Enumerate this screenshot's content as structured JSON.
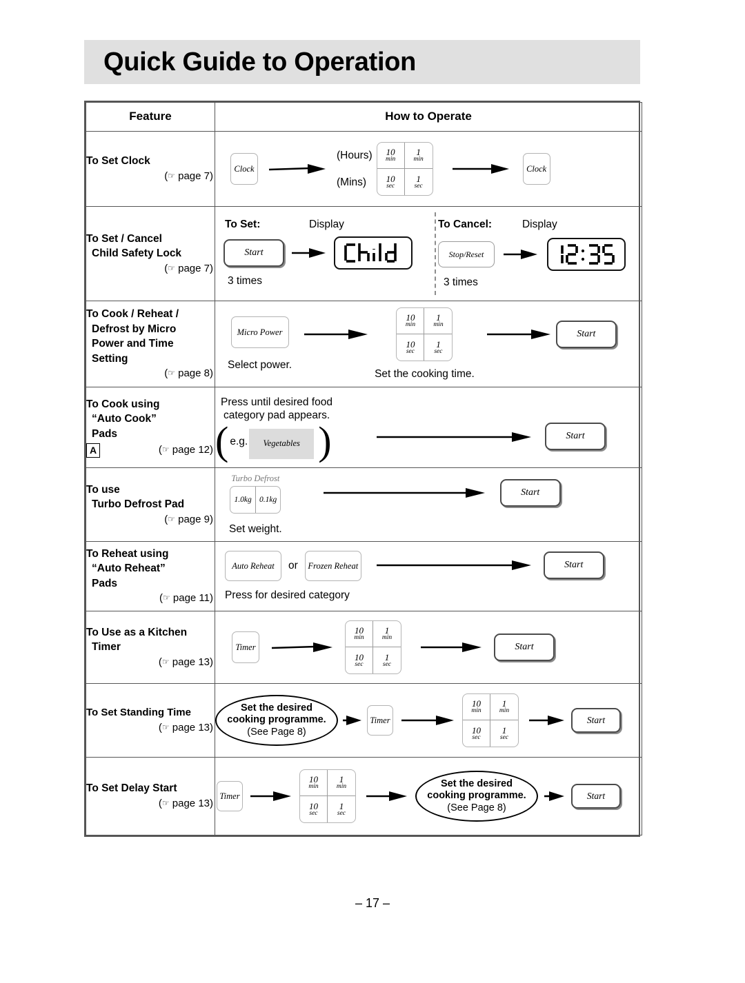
{
  "page": {
    "title": "Quick Guide to Operation",
    "footer": "– 17 –"
  },
  "table": {
    "headers": {
      "feature": "Feature",
      "how_to_operate": "How to Operate"
    },
    "rows": [
      {
        "id": "set-clock",
        "feature_lines": [
          "To Set Clock"
        ],
        "page_ref": "(☞ page 7)",
        "page_ref_prefix": "(",
        "page_ref_text": "page 7)",
        "steps": {
          "clock_pad": "Clock",
          "hours_label": "(Hours)",
          "mins_label": "(Mins)",
          "grid": [
            {
              "big": "10",
              "sml": "min"
            },
            {
              "big": "1",
              "sml": "min"
            },
            {
              "big": "10",
              "sml": "sec"
            },
            {
              "big": "1",
              "sml": "sec"
            }
          ],
          "clock_pad_2": "Clock"
        }
      },
      {
        "id": "child-safety-lock",
        "feature_lines": [
          "To Set / Cancel",
          "Child Safety Lock"
        ],
        "page_ref_text": "page 7)",
        "steps": {
          "to_set_label": "To Set:",
          "display_label_left": "Display",
          "start_pad": "Start",
          "set_times": "3 times",
          "display_left": "Child",
          "to_cancel_label": "To Cancel:",
          "display_label_right": "Display",
          "stop_reset_pad": "Stop/Reset",
          "cancel_times": "3 times",
          "display_right": "12:35"
        }
      },
      {
        "id": "micro-power",
        "feature_lines": [
          "To Cook / Reheat /",
          "Defrost by Micro",
          "Power and Time",
          "Setting"
        ],
        "page_ref_text": "page 8)",
        "steps": {
          "micro_power_pad": "Micro Power",
          "select_power_caption": "Select power.",
          "grid": [
            {
              "big": "10",
              "sml": "min"
            },
            {
              "big": "1",
              "sml": "min"
            },
            {
              "big": "10",
              "sml": "sec"
            },
            {
              "big": "1",
              "sml": "sec"
            }
          ],
          "set_time_caption": "Set the cooking time.",
          "start_pad": "Start"
        }
      },
      {
        "id": "auto-cook",
        "feature_lines": [
          "To Cook using",
          "“Auto Cook”",
          "Pads"
        ],
        "feature_badge": "A",
        "page_ref_text": "page 12)",
        "steps": {
          "instruction_line1": "Press until desired food",
          "instruction_line2": "category pad appears.",
          "eg_label": "e.g.",
          "category_pad": "Vegetables",
          "start_pad": "Start"
        }
      },
      {
        "id": "turbo-defrost",
        "feature_lines": [
          "To use",
          "Turbo Defrost Pad"
        ],
        "page_ref_text": "page 9)",
        "steps": {
          "pad_title": "Turbo Defrost",
          "weight_cells": [
            "1.0kg",
            "0.1kg"
          ],
          "set_weight_caption": "Set weight.",
          "start_pad": "Start"
        }
      },
      {
        "id": "auto-reheat",
        "feature_lines": [
          "To Reheat using",
          "“Auto Reheat”",
          "Pads"
        ],
        "page_ref_text": "page 11)",
        "steps": {
          "auto_reheat_pad": "Auto Reheat",
          "or_label": "or",
          "frozen_reheat_pad": "Frozen Reheat",
          "caption": "Press for desired category",
          "start_pad": "Start"
        }
      },
      {
        "id": "kitchen-timer",
        "feature_lines": [
          "To Use as a Kitchen",
          "Timer"
        ],
        "page_ref_text": "page 13)",
        "steps": {
          "timer_pad": "Timer",
          "grid": [
            {
              "big": "10",
              "sml": "min"
            },
            {
              "big": "1",
              "sml": "min"
            },
            {
              "big": "10",
              "sml": "sec"
            },
            {
              "big": "1",
              "sml": "sec"
            }
          ],
          "start_pad": "Start"
        }
      },
      {
        "id": "standing-time",
        "feature_lines": [
          "To Set Standing Time"
        ],
        "page_ref_text": "page 13)",
        "steps": {
          "callout_line1": "Set the desired",
          "callout_line2": "cooking programme.",
          "callout_line3": "(See Page 8)",
          "timer_pad": "Timer",
          "grid": [
            {
              "big": "10",
              "sml": "min"
            },
            {
              "big": "1",
              "sml": "min"
            },
            {
              "big": "10",
              "sml": "sec"
            },
            {
              "big": "1",
              "sml": "sec"
            }
          ],
          "start_pad": "Start"
        }
      },
      {
        "id": "delay-start",
        "feature_lines": [
          "To Set Delay Start"
        ],
        "page_ref_text": "page 13)",
        "steps": {
          "timer_pad": "Timer",
          "grid": [
            {
              "big": "10",
              "sml": "min"
            },
            {
              "big": "1",
              "sml": "min"
            },
            {
              "big": "10",
              "sml": "sec"
            },
            {
              "big": "1",
              "sml": "sec"
            }
          ],
          "callout_line1": "Set the desired",
          "callout_line2": "cooking programme.",
          "callout_line3": "(See Page 8)",
          "start_pad": "Start"
        }
      }
    ]
  },
  "colors": {
    "banner_gray": "#e0e0e0",
    "pad_gray": "#dcdcdc",
    "border_gray": "#555555",
    "pad_border": "#b3b3b3"
  }
}
